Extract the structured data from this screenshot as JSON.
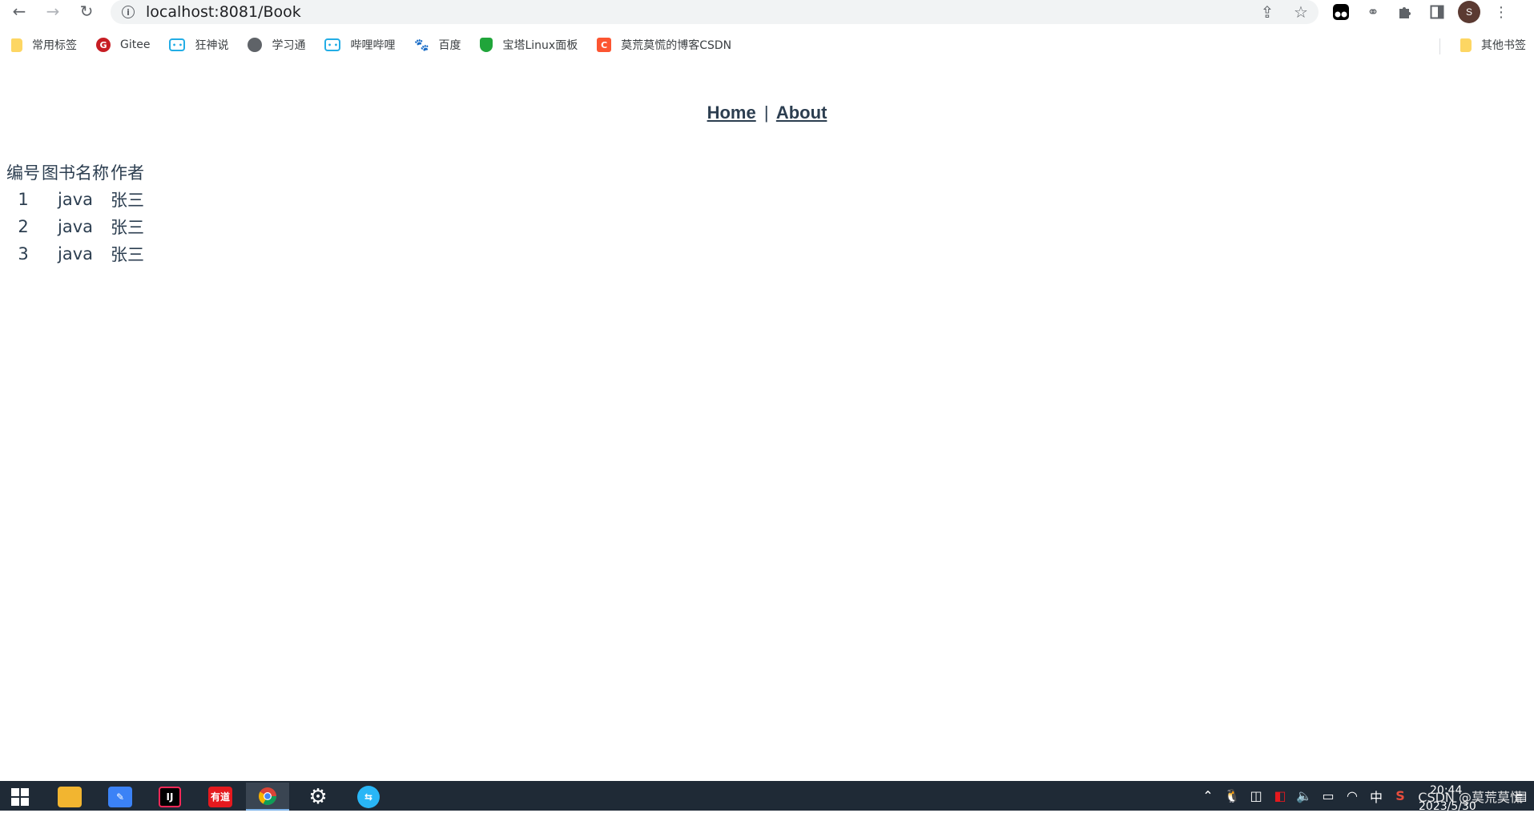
{
  "browser": {
    "url": "localhost:8081/Book",
    "avatar_letter": "S",
    "bookmarks": [
      {
        "label": "常用标签",
        "icon": "folder-icon"
      },
      {
        "label": "Gitee",
        "icon": "gitee-icon"
      },
      {
        "label": "狂神说",
        "icon": "bilibili-icon"
      },
      {
        "label": "学习通",
        "icon": "globe-icon"
      },
      {
        "label": "哔哩哔哩",
        "icon": "bilibili-icon"
      },
      {
        "label": "百度",
        "icon": "baidu-icon"
      },
      {
        "label": "宝塔Linux面板",
        "icon": "baota-icon"
      },
      {
        "label": "莫荒莫慌的博客CSDN",
        "icon": "csdn-icon"
      }
    ],
    "other_bookmarks": "其他书签"
  },
  "app_nav": {
    "home": "Home",
    "separator": "|",
    "about": "About"
  },
  "book_table": {
    "headers": [
      "编号",
      "图书名称",
      "作者"
    ],
    "rows": [
      [
        "1",
        "java",
        "张三"
      ],
      [
        "2",
        "java",
        "张三"
      ],
      [
        "3",
        "java",
        "张三"
      ]
    ]
  },
  "taskbar": {
    "time": "20:44",
    "date": "2023/5/30",
    "ime": "中",
    "watermark": "CSDN @莫荒莫慌"
  },
  "colors": {
    "text": "#2c3e50",
    "taskbar": "#1f2a36",
    "omnibox": "#f1f3f4"
  }
}
